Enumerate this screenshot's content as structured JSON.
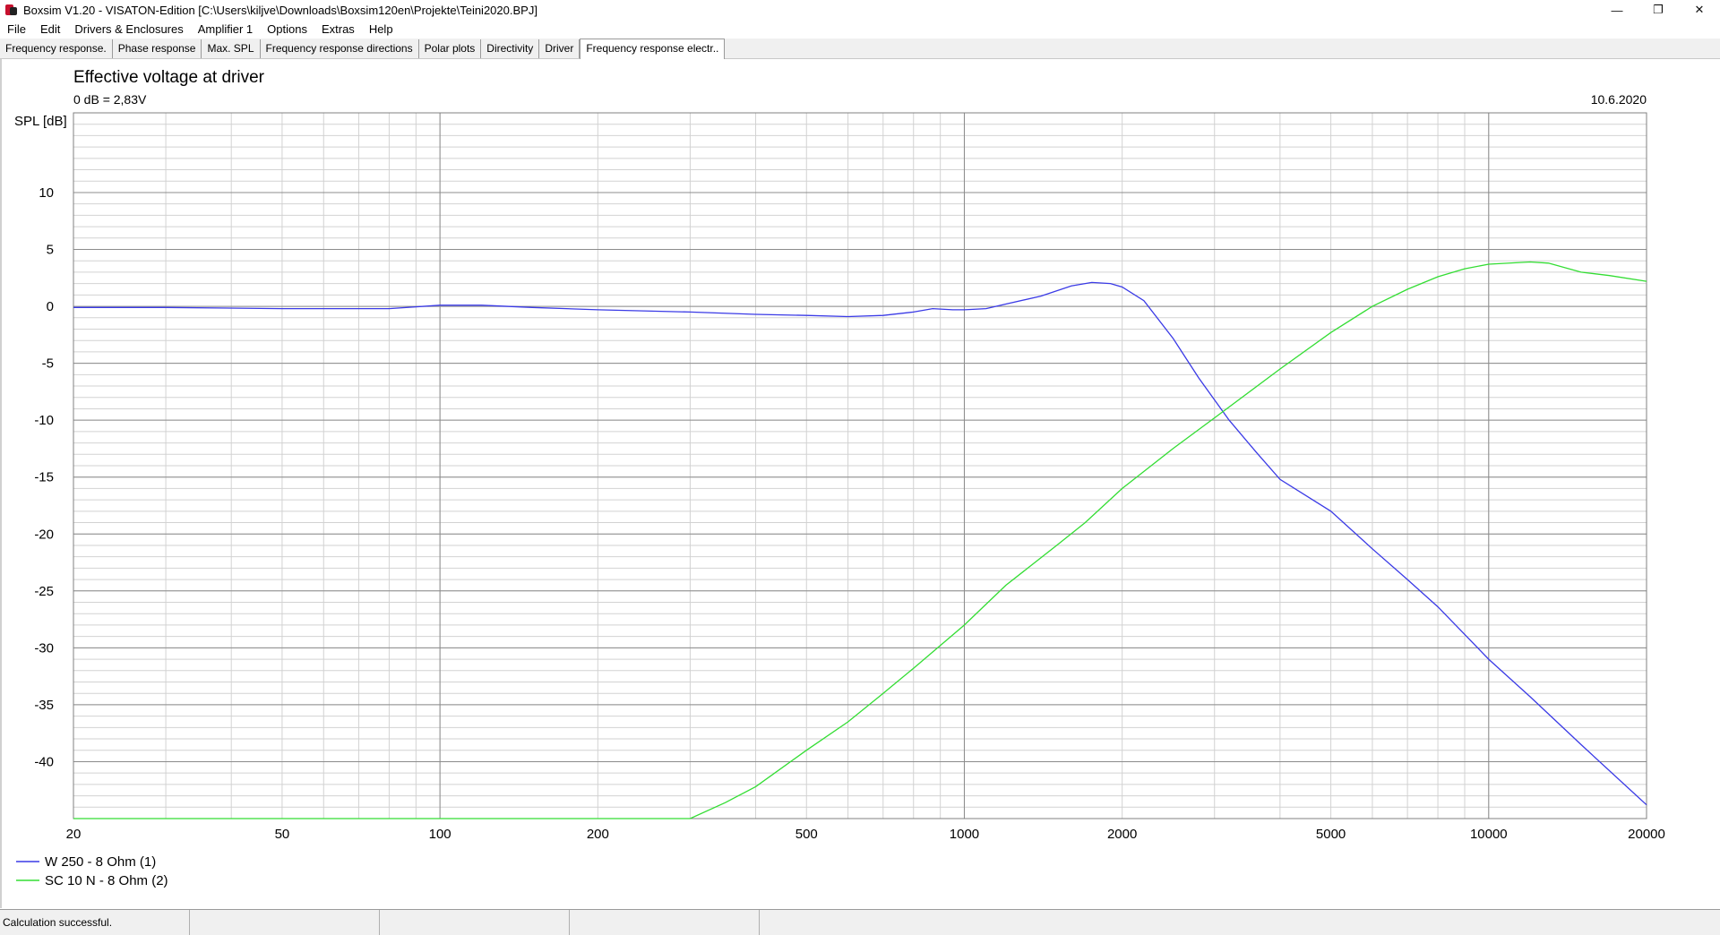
{
  "window": {
    "title": "Boxsim V1.20 - VISATON-Edition [C:\\Users\\kiljve\\Downloads\\Boxsim120en\\Projekte\\Teini2020.BPJ]",
    "minimize_glyph": "—",
    "maximize_glyph": "❐",
    "close_glyph": "✕"
  },
  "menu": [
    "File",
    "Edit",
    "Drivers & Enclosures",
    "Amplifier 1",
    "Options",
    "Extras",
    "Help"
  ],
  "tabs": [
    {
      "label": "Frequency response."
    },
    {
      "label": "Phase response"
    },
    {
      "label": "Max. SPL"
    },
    {
      "label": "Frequency response directions"
    },
    {
      "label": "Polar plots"
    },
    {
      "label": "Directivity"
    },
    {
      "label": "Driver"
    },
    {
      "label": "Frequency response electr..",
      "active": true
    }
  ],
  "status": {
    "message": "Calculation successful."
  },
  "chart_data": {
    "type": "line",
    "title": "Effective voltage at driver",
    "subtitle": "0 dB = 2,83V",
    "date": "10.6.2020",
    "ylabel": "SPL [dB]",
    "xscale": "log",
    "xlim": [
      20,
      20000
    ],
    "ylim": [
      -45,
      17
    ],
    "xticks": [
      20,
      50,
      100,
      200,
      500,
      1000,
      2000,
      5000,
      10000,
      20000
    ],
    "yticks": [
      10,
      5,
      0,
      -5,
      -10,
      -15,
      -20,
      -25,
      -30,
      -35,
      -40
    ],
    "grid": true,
    "legend": "bottom-left",
    "series": [
      {
        "name": "W 250 - 8 Ohm (1)",
        "color": "#3a3ae6",
        "points": [
          [
            20,
            -0.1
          ],
          [
            30,
            -0.1
          ],
          [
            50,
            -0.2
          ],
          [
            80,
            -0.2
          ],
          [
            100,
            0.1
          ],
          [
            120,
            0.1
          ],
          [
            150,
            -0.1
          ],
          [
            200,
            -0.3
          ],
          [
            300,
            -0.5
          ],
          [
            400,
            -0.7
          ],
          [
            500,
            -0.8
          ],
          [
            600,
            -0.9
          ],
          [
            700,
            -0.8
          ],
          [
            800,
            -0.5
          ],
          [
            870,
            -0.2
          ],
          [
            950,
            -0.3
          ],
          [
            1000,
            -0.3
          ],
          [
            1100,
            -0.2
          ],
          [
            1200,
            0.2
          ],
          [
            1400,
            0.9
          ],
          [
            1600,
            1.8
          ],
          [
            1750,
            2.1
          ],
          [
            1900,
            2.0
          ],
          [
            2000,
            1.7
          ],
          [
            2200,
            0.5
          ],
          [
            2500,
            -2.8
          ],
          [
            2800,
            -6.3
          ],
          [
            3200,
            -10.0
          ],
          [
            3600,
            -12.8
          ],
          [
            4000,
            -15.2
          ],
          [
            5000,
            -18.0
          ],
          [
            6000,
            -21.3
          ],
          [
            7000,
            -24.0
          ],
          [
            8000,
            -26.4
          ],
          [
            10000,
            -31.0
          ],
          [
            12000,
            -34.3
          ],
          [
            15000,
            -38.5
          ],
          [
            20000,
            -43.8
          ]
        ]
      },
      {
        "name": "SC 10 N - 8 Ohm (2)",
        "color": "#33dd33",
        "points": [
          [
            20,
            -45.0
          ],
          [
            100,
            -45.0
          ],
          [
            200,
            -45.0
          ],
          [
            300,
            -45.0
          ],
          [
            350,
            -43.6
          ],
          [
            400,
            -42.2
          ],
          [
            500,
            -39.0
          ],
          [
            600,
            -36.5
          ],
          [
            700,
            -34.0
          ],
          [
            800,
            -31.8
          ],
          [
            1000,
            -28.0
          ],
          [
            1200,
            -24.5
          ],
          [
            1500,
            -21.0
          ],
          [
            1700,
            -19.0
          ],
          [
            2000,
            -16.0
          ],
          [
            2500,
            -12.5
          ],
          [
            3000,
            -9.8
          ],
          [
            4000,
            -5.5
          ],
          [
            5000,
            -2.3
          ],
          [
            6000,
            0.0
          ],
          [
            7000,
            1.5
          ],
          [
            8000,
            2.6
          ],
          [
            9000,
            3.3
          ],
          [
            10000,
            3.7
          ],
          [
            12000,
            3.9
          ],
          [
            13000,
            3.8
          ],
          [
            15000,
            3.0
          ],
          [
            17000,
            2.7
          ],
          [
            20000,
            2.2
          ]
        ]
      }
    ]
  }
}
